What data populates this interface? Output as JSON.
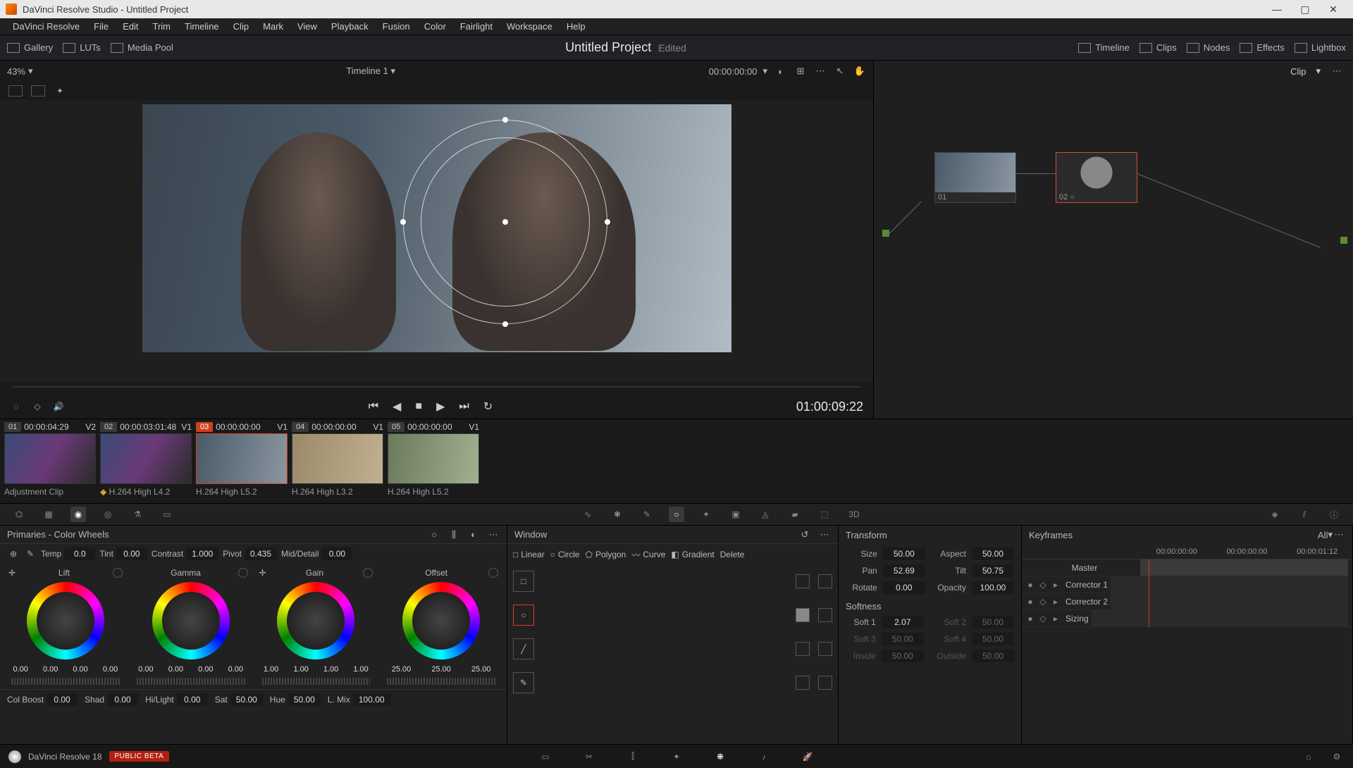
{
  "titlebar": {
    "text": "DaVinci Resolve Studio - Untitled Project"
  },
  "menu": [
    "DaVinci Resolve",
    "File",
    "Edit",
    "Trim",
    "Timeline",
    "Clip",
    "Mark",
    "View",
    "Playback",
    "Fusion",
    "Color",
    "Fairlight",
    "Workspace",
    "Help"
  ],
  "toolbar": {
    "left": [
      {
        "name": "gallery",
        "label": "Gallery"
      },
      {
        "name": "luts",
        "label": "LUTs"
      },
      {
        "name": "mediapool",
        "label": "Media Pool"
      }
    ],
    "project": "Untitled Project",
    "edited": "Edited",
    "right": [
      {
        "name": "timeline",
        "label": "Timeline"
      },
      {
        "name": "clips",
        "label": "Clips"
      },
      {
        "name": "nodes",
        "label": "Nodes"
      },
      {
        "name": "effects",
        "label": "Effects"
      },
      {
        "name": "lightbox",
        "label": "Lightbox"
      }
    ]
  },
  "viewer": {
    "zoom": "43%",
    "timeline_name": "Timeline 1",
    "timecode": "00:00:00:00",
    "play_timecode": "01:00:09:22"
  },
  "nodes": {
    "scope": "Clip",
    "n1": "01",
    "n2": "02"
  },
  "clips": [
    {
      "num": "01",
      "tc": "00:00:04:29",
      "trk": "V2",
      "label": "Adjustment Clip"
    },
    {
      "num": "02",
      "tc": "00:00:03:01:48",
      "trk": "V1",
      "label": "H.264 High L4.2"
    },
    {
      "num": "03",
      "tc": "00:00:00:00",
      "trk": "V1",
      "label": "H.264 High L5.2"
    },
    {
      "num": "04",
      "tc": "00:00:00:00",
      "trk": "V1",
      "label": "H.264 High L3.2"
    },
    {
      "num": "05",
      "tc": "00:00:00:00",
      "trk": "V1",
      "label": "H.264 High L5.2"
    }
  ],
  "primaries": {
    "title": "Primaries - Color Wheels",
    "top": {
      "temp_l": "Temp",
      "temp": "0.0",
      "tint_l": "Tint",
      "tint": "0.00",
      "contrast_l": "Contrast",
      "contrast": "1.000",
      "pivot_l": "Pivot",
      "pivot": "0.435",
      "md_l": "Mid/Detail",
      "md": "0.00"
    },
    "wheels": [
      {
        "name": "Lift",
        "vals": [
          "0.00",
          "0.00",
          "0.00",
          "0.00"
        ]
      },
      {
        "name": "Gamma",
        "vals": [
          "0.00",
          "0.00",
          "0.00",
          "0.00"
        ]
      },
      {
        "name": "Gain",
        "vals": [
          "1.00",
          "1.00",
          "1.00",
          "1.00"
        ]
      },
      {
        "name": "Offset",
        "vals": [
          "25.00",
          "25.00",
          "25.00"
        ]
      }
    ],
    "bottom": {
      "cb_l": "Col Boost",
      "cb": "0.00",
      "shad_l": "Shad",
      "shad": "0.00",
      "hl_l": "Hi/Light",
      "hl": "0.00",
      "sat_l": "Sat",
      "sat": "50.00",
      "hue_l": "Hue",
      "hue": "50.00",
      "lm_l": "L. Mix",
      "lm": "100.00"
    }
  },
  "window": {
    "title": "Window",
    "tools": [
      "Linear",
      "Circle",
      "Polygon",
      "Curve",
      "Gradient",
      "Delete"
    ]
  },
  "transform": {
    "title": "Transform",
    "size_l": "Size",
    "size": "50.00",
    "aspect_l": "Aspect",
    "aspect": "50.00",
    "pan_l": "Pan",
    "pan": "52.69",
    "tilt_l": "Tilt",
    "tilt": "50.75",
    "rotate_l": "Rotate",
    "rotate": "0.00",
    "opacity_l": "Opacity",
    "opacity": "100.00",
    "soft_title": "Softness",
    "s1_l": "Soft 1",
    "s1": "2.07",
    "s2_l": "Soft 2",
    "s2": "50.00",
    "s3_l": "Soft 3",
    "s3": "50.00",
    "s4_l": "Soft 4",
    "s4": "50.00",
    "in_l": "Inside",
    "in": "50.00",
    "out_l": "Outside",
    "out": "50.00"
  },
  "keyframes": {
    "title": "Keyframes",
    "all": "All",
    "tc1": "00:00:00:00",
    "tc2": "00:00:00:00",
    "tc3": "00:00:01:12",
    "rows": [
      "Master",
      "Corrector 1",
      "Corrector 2",
      "Sizing"
    ]
  },
  "bottombar": {
    "app": "DaVinci Resolve 18",
    "badge": "PUBLIC BETA"
  }
}
